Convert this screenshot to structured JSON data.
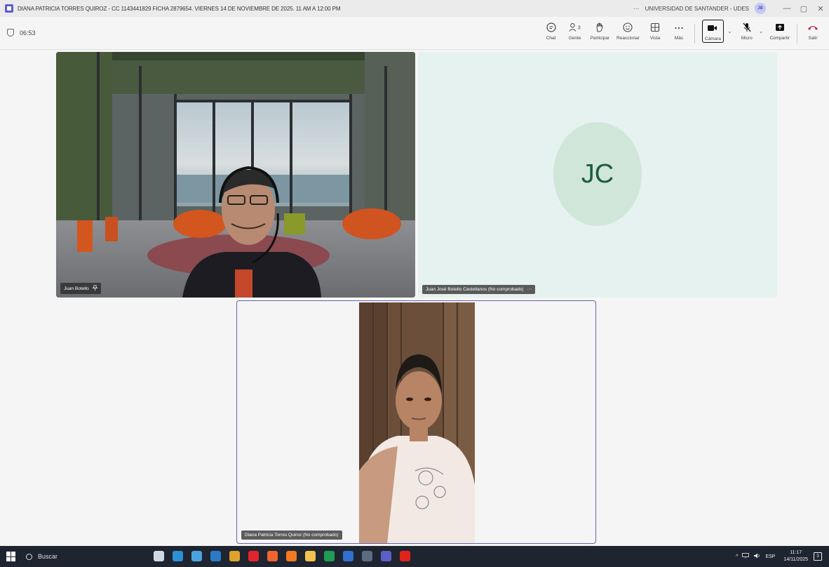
{
  "window": {
    "title": "DIANA PATRICIA TORRES QUIROZ - CC 1143441829 FICHA 2879654. VIERNES 14 DE NOVIEMBRE DE 2025. 11 AM A 12:00 PM",
    "more": "···",
    "org": "UNIVERSIDAD DE SANTANDER - UDES",
    "account_initials": "JB",
    "minimize": "—",
    "restore": "▢",
    "close": "✕"
  },
  "meeting": {
    "timer": "06:53"
  },
  "toolbar": {
    "chat": "Chat",
    "people": "Gente",
    "people_count": "3",
    "raise_hand": "Participar",
    "react": "Reaccionar",
    "view": "Vista",
    "more": "Más",
    "camera": "Cámara",
    "mic": "Micro",
    "share": "Compartir",
    "leave": "Salir"
  },
  "participants": [
    {
      "name": "Juan Botello",
      "initials": "",
      "status_icon": "pin-icon"
    },
    {
      "name": "Juan José Botello Castellanos (No comprobado)",
      "initials": "JC",
      "more": "···"
    },
    {
      "name": "Diana Patricia Torres Quiroz (No comprobado)",
      "initials": ""
    }
  ],
  "taskbar": {
    "search_label": "Buscar",
    "language": "ESP",
    "time": "11:17",
    "date": "14/11/2025",
    "notification_count": "3",
    "apps": [
      {
        "name": "task-view",
        "color": "#cfd8e3"
      },
      {
        "name": "edge",
        "color": "#2d8fd5"
      },
      {
        "name": "store",
        "color": "#4aa3df"
      },
      {
        "name": "outlook",
        "color": "#2b79c9"
      },
      {
        "name": "chrome",
        "color": "#e0a22b"
      },
      {
        "name": "opera",
        "color": "#e3242b"
      },
      {
        "name": "brave",
        "color": "#f0652f"
      },
      {
        "name": "firefox",
        "color": "#f27b22"
      },
      {
        "name": "files",
        "color": "#f2c14e"
      },
      {
        "name": "excel",
        "color": "#1f9d55"
      },
      {
        "name": "word",
        "color": "#2f6fd1"
      },
      {
        "name": "calculator",
        "color": "#5a6b82"
      },
      {
        "name": "teams",
        "color": "#5b5fc7"
      },
      {
        "name": "acrobat",
        "color": "#e2231a"
      }
    ]
  }
}
